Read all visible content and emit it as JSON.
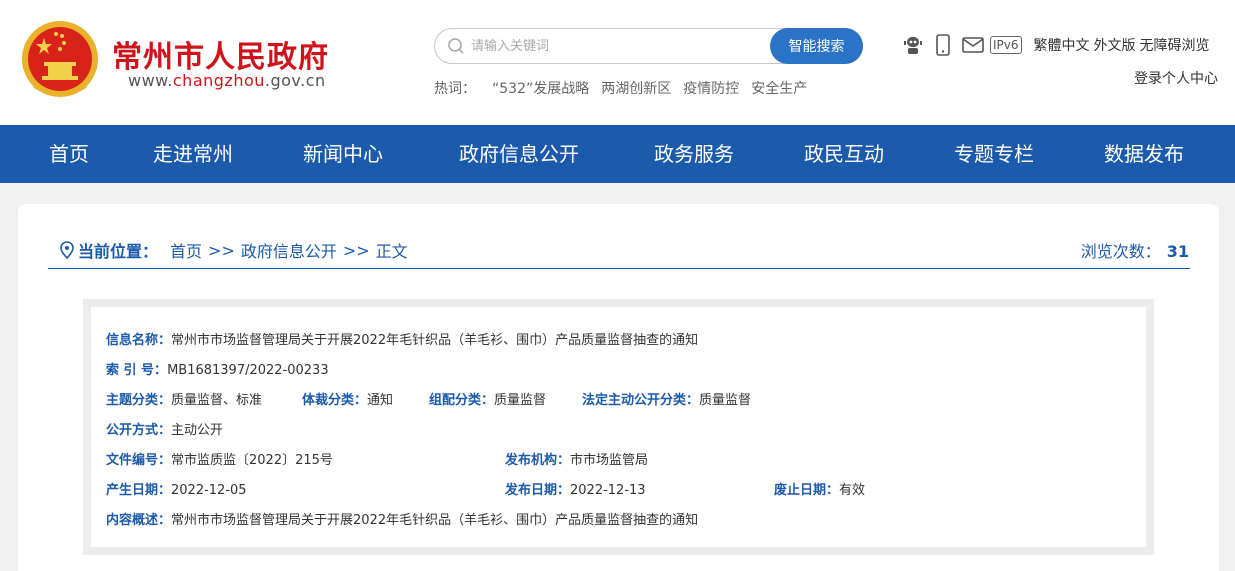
{
  "header": {
    "site_title": "常州市人民政府",
    "domain_prefix": "www.",
    "domain_main": "changzhou",
    "domain_suffix": ".gov.cn",
    "emblem_icon": "national-emblem-icon"
  },
  "search": {
    "placeholder": "请输入关键词",
    "button_label": "智能搜索"
  },
  "hotwords": {
    "label": "热词：",
    "items": [
      "“532”发展战略",
      "两湖创新区",
      "疫情防控",
      "安全生产"
    ]
  },
  "tools": {
    "icons": [
      "robot-icon",
      "mobile-icon",
      "mail-icon"
    ],
    "ipv6_label": "IPv6",
    "traditional_label": "繁體中文",
    "foreign_label": "外文版",
    "accessible_label": "无障碍浏览",
    "login_label": "登录个人中心"
  },
  "nav": {
    "items": [
      "首页",
      "走进常州",
      "新闻中心",
      "政府信息公开",
      "政务服务",
      "政民互动",
      "专题专栏",
      "数据发布"
    ]
  },
  "breadcrumb": {
    "label": "当前位置：",
    "items": [
      "首页",
      "政府信息公开",
      "正文"
    ],
    "separator": ">>"
  },
  "views": {
    "label": "浏览次数：",
    "count": "31"
  },
  "info": {
    "name_label": "信息名称：",
    "name": "常州市市场监督管理局关于开展2022年毛针织品（羊毛衫、围巾）产品质量监督抽查的通知",
    "index_label": "索 引 号：",
    "index": "MB1681397/2022-00233",
    "topic_label": "主题分类：",
    "topic": "质量监督、标准",
    "genre_label": "体裁分类：",
    "genre": "通知",
    "org_label": "组配分类：",
    "org": "质量监督",
    "legal_label": "法定主动公开分类：",
    "legal": "质量监督",
    "mode_label": "公开方式：",
    "mode": "主动公开",
    "doc_no_label": "文件编号：",
    "doc_no": "常市监质监〔2022〕215号",
    "publisher_label": "发布机构：",
    "publisher": "市市场监管局",
    "created_label": "产生日期：",
    "created": "2022-12-05",
    "published_label": "发布日期：",
    "published": "2022-12-13",
    "expire_label": "废止日期：",
    "expire": "有效",
    "summary_label": "内容概述：",
    "summary": "常州市市场监督管理局关于开展2022年毛针织品（羊毛衫、围巾）产品质量监督抽查的通知"
  },
  "colors": {
    "brand_red": "#d0121b",
    "nav_blue": "#1c5aab",
    "search_blue": "#2b73c7"
  }
}
